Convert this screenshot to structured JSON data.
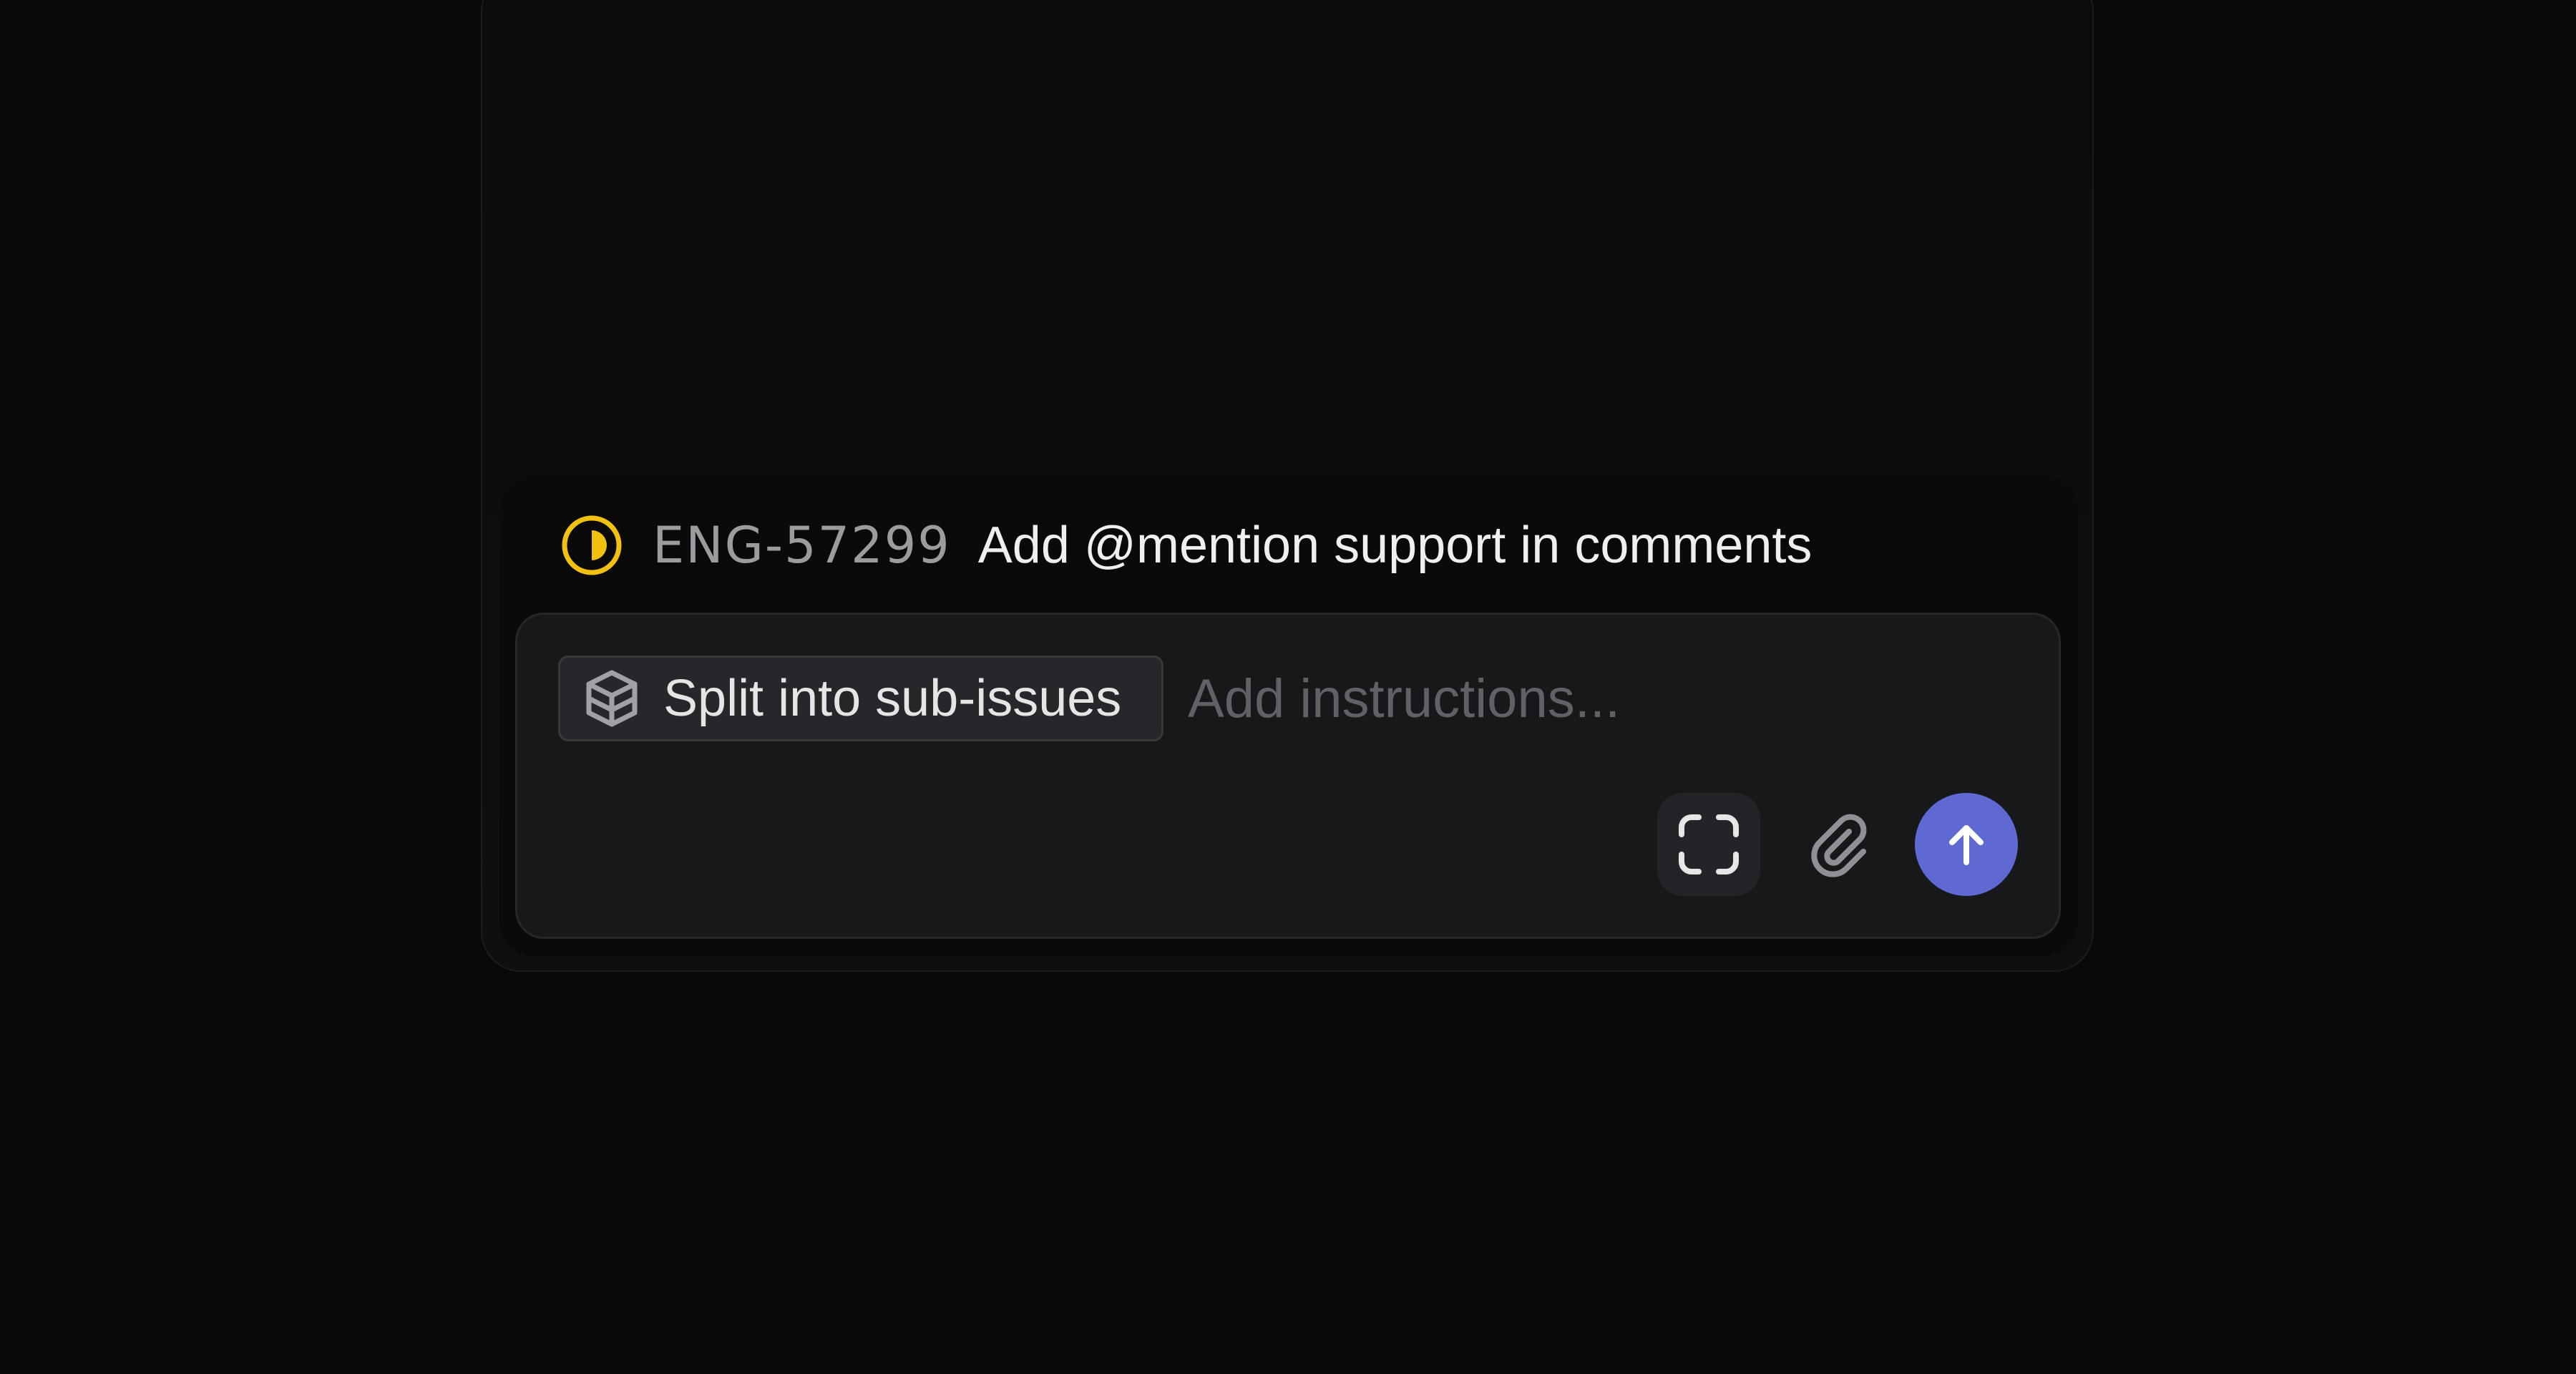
{
  "issue": {
    "status_icon": "in-progress-half-circle-icon",
    "status_color": "#f2c00f",
    "id": "ENG-57299",
    "title": "Add @mention support in comments"
  },
  "composer": {
    "chip": {
      "icon": "cube-icon",
      "label": "Split into sub-issues"
    },
    "input_value": "",
    "input_placeholder": "Add instructions...",
    "buttons": {
      "screenshot_icon": "screenshot-frame-icon",
      "attach_icon": "paperclip-icon",
      "send_icon": "arrow-up-icon"
    }
  },
  "colors": {
    "accent": "#5e6ad2",
    "background": "#08090a",
    "composer_bg": "#17181a"
  }
}
